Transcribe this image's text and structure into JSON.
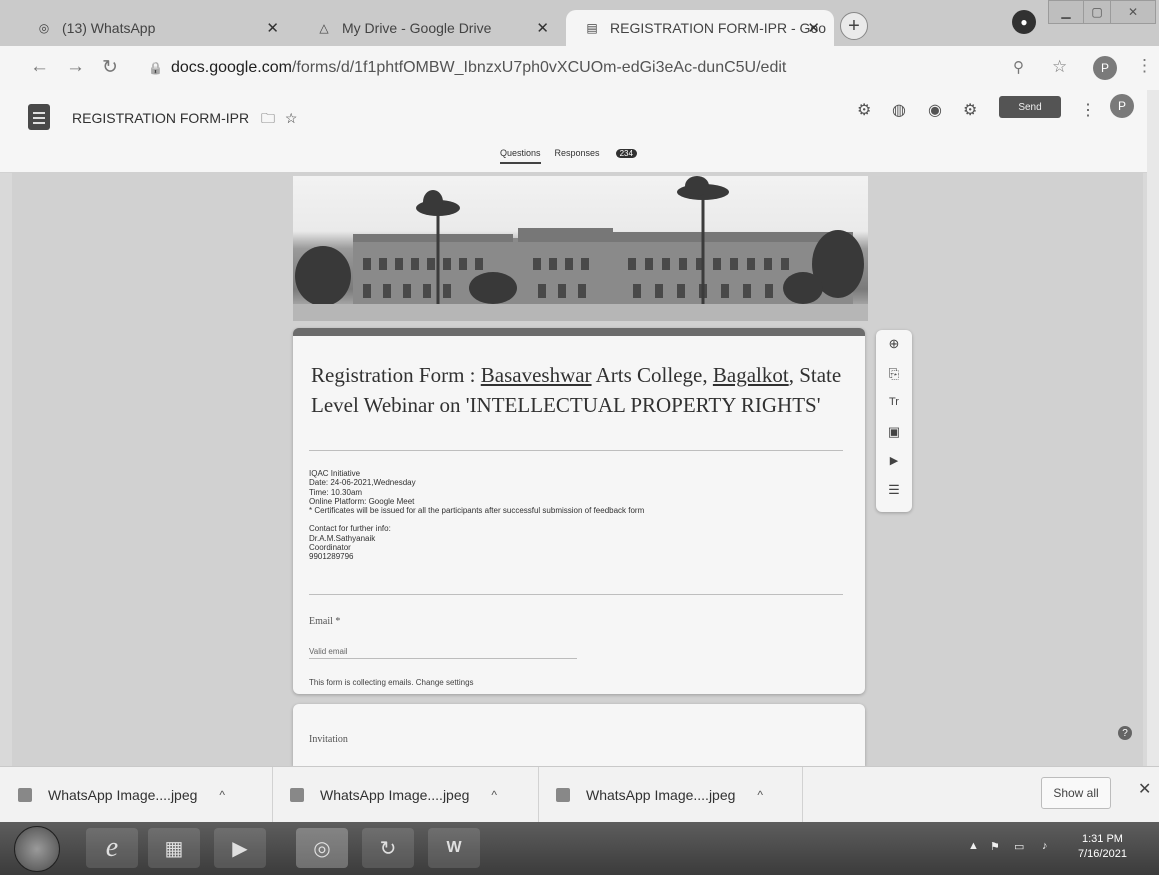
{
  "browser": {
    "tabs": [
      {
        "title": "(13) WhatsApp",
        "icon": "whatsapp-icon"
      },
      {
        "title": "My Drive - Google Drive",
        "icon": "google-drive-icon"
      },
      {
        "title": "REGISTRATION FORM-IPR - Goo",
        "icon": "google-forms-icon",
        "active": true
      }
    ],
    "new_tab_label": "+",
    "url_domain": "docs.google.com",
    "url_path": "/forms/d/1f1phtfOMBW_IbnzxU7ph0vXCUOm-edGi3eAc-dunC5U/edit",
    "profile_initial": "P"
  },
  "forms_header": {
    "title": "REGISTRATION FORM-IPR",
    "send_label": "Send",
    "profile_initial": "P",
    "tabs": {
      "questions": "Questions",
      "responses": "Responses",
      "responses_count": "234"
    }
  },
  "form": {
    "heading_prefix": "Registration Form : ",
    "heading_link1": "Basaveshwar",
    "heading_mid": " Arts College, ",
    "heading_link2": "Bagalkot",
    "heading_rest": ", State Level Webinar on 'INTELLECTUAL PROPERTY RIGHTS'",
    "description": [
      "IQAC Initiative",
      "Date: 24-06-2021,Wednesday",
      "Time: 10.30am",
      "Online Platform: Google Meet",
      "* Certificates will be issued for all the participants after successful submission of feedback form",
      "",
      "Contact for further info:",
      "Dr.A.M.Sathyanaik",
      "Coordinator",
      "9901289796"
    ],
    "email_label": "Email *",
    "email_placeholder": "Valid email",
    "collect_note": "This form is collecting emails.",
    "change_settings": "Change settings",
    "next_section_label": "Invitation"
  },
  "side_toolbar": [
    {
      "icon": "add-question-icon",
      "glyph": "⊕"
    },
    {
      "icon": "import-questions-icon",
      "glyph": "⎘"
    },
    {
      "icon": "title-text-icon",
      "glyph": "Tr"
    },
    {
      "icon": "image-icon",
      "glyph": "▣"
    },
    {
      "icon": "video-icon",
      "glyph": "▶"
    },
    {
      "icon": "section-icon",
      "glyph": "☰"
    }
  ],
  "downloads": {
    "items": [
      "WhatsApp Image....jpeg",
      "WhatsApp Image....jpeg",
      "WhatsApp Image....jpeg"
    ],
    "show_all": "Show all"
  },
  "taskbar": {
    "time": "1:31 PM",
    "date": "7/16/2021"
  }
}
